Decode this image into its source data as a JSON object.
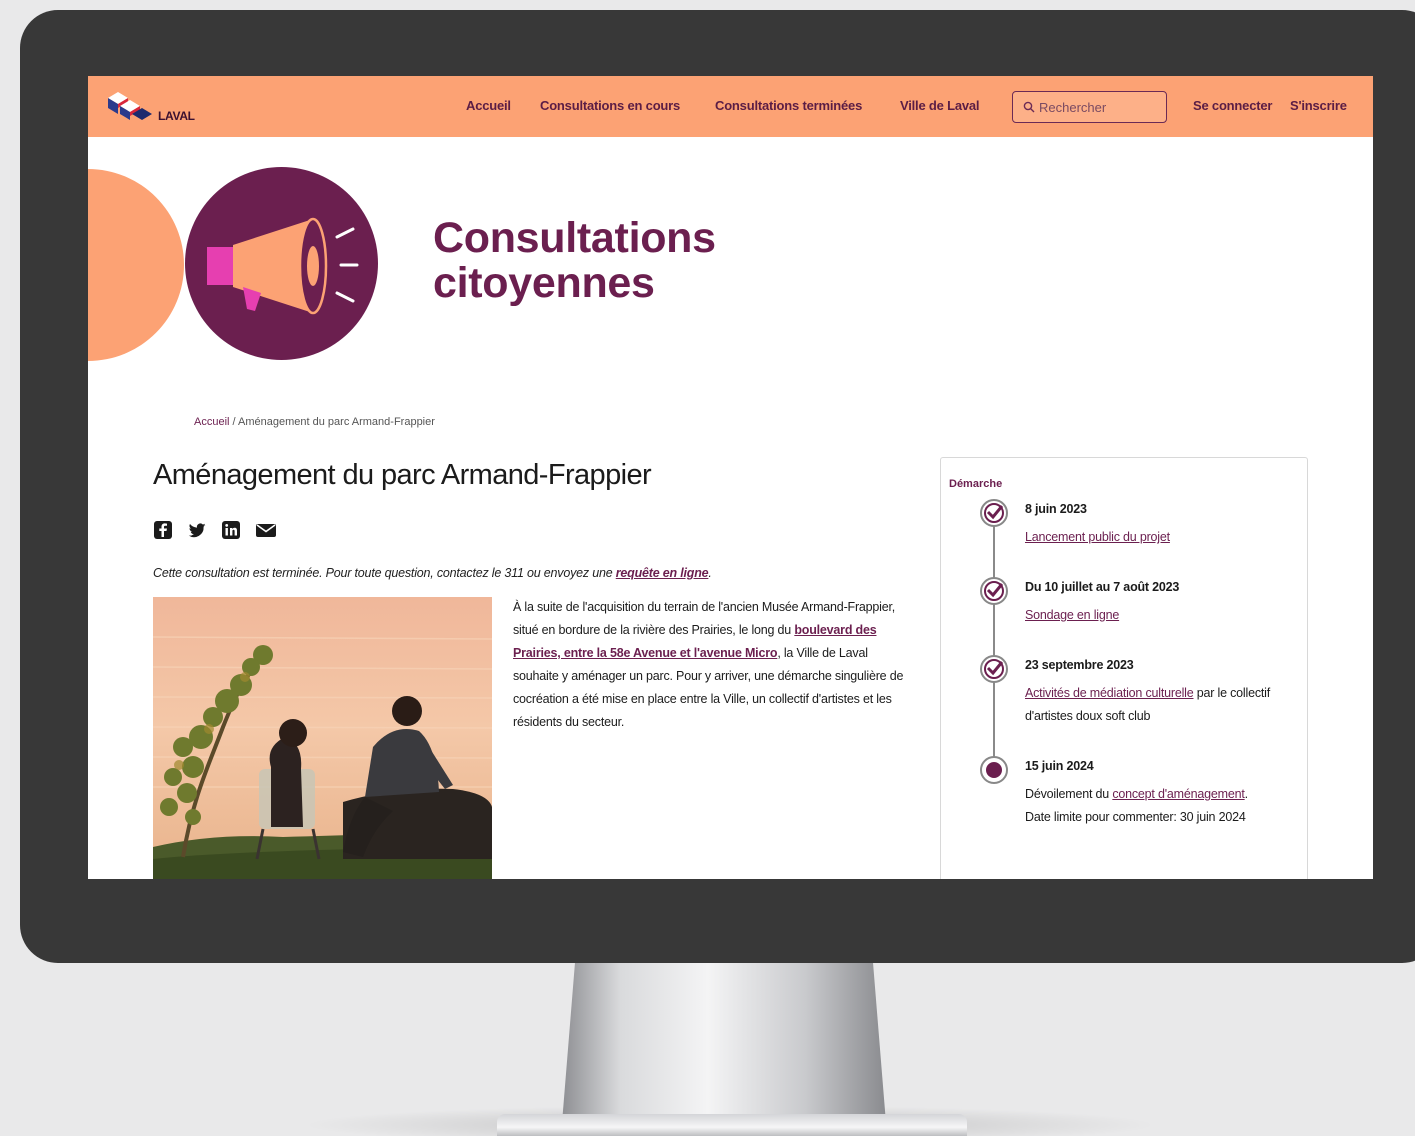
{
  "nav": {
    "logo_text": "LAVAL",
    "links": [
      "Accueil",
      "Consultations en cours",
      "Consultations terminées",
      "Ville de Laval"
    ],
    "search_placeholder": "Rechercher",
    "login": "Se connecter",
    "signup": "S'inscrire"
  },
  "hero": {
    "title_line1": "Consultations",
    "title_line2": "citoyennes"
  },
  "breadcrumb": {
    "home": "Accueil",
    "separator": " / ",
    "current": "Aménagement du parc Armand-Frappier"
  },
  "page": {
    "title": "Aménagement du parc Armand-Frappier",
    "share_icons": [
      "facebook-icon",
      "twitter-icon",
      "linkedin-icon",
      "email-icon"
    ],
    "notice_text": "Cette consultation est terminée. Pour toute question, contactez le 311 ou envoyez une ",
    "notice_link": "requête en ligne",
    "notice_end": ".",
    "intro_1": "À la suite de l'acquisition du terrain de l'ancien Musée Armand-Frappier, situé en bordure de la rivière des Prairies, le long du ",
    "intro_link": "boulevard des Prairies, entre la 58e Avenue et l'avenue Micro",
    "intro_2": ", la Ville de Laval souhaite y aménager un parc. Pour y arriver, une démarche singulière de cocréation a été mise en place entre la Ville, un collectif d'artistes et les résidents du secteur."
  },
  "sidebar": {
    "title": "Démarche",
    "steps": [
      {
        "date": "8 juin 2023",
        "pre": "",
        "link": "Lancement public du projet",
        "post": "",
        "status": "done"
      },
      {
        "date": "Du 10 juillet au 7 août 2023",
        "pre": "",
        "link": "Sondage en ligne",
        "post": "",
        "status": "done"
      },
      {
        "date": "23 septembre 2023",
        "pre": "",
        "link": "Activités de médiation culturelle",
        "post": " par le collectif d'artistes doux soft club",
        "status": "done"
      },
      {
        "date": "15 juin 2024",
        "pre": "Dévoilement du ",
        "link": "concept d'aménagement",
        "post": ". Date limite pour commenter: 30 juin 2024",
        "status": "current"
      }
    ]
  },
  "colors": {
    "accent_orange": "#fca274",
    "brand_purple": "#6b1f4f",
    "bezel": "#383838"
  }
}
